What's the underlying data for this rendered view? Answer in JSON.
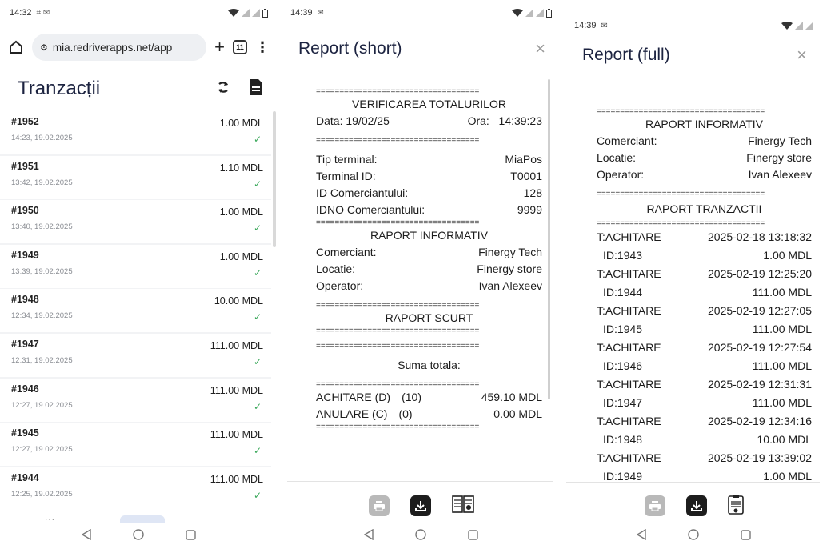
{
  "panel1": {
    "status_time": "14:32",
    "url": "mia.redriverapps.net/app",
    "tab_count": "11",
    "app_title": "Tranzacții",
    "transactions": [
      {
        "id": "#1952",
        "date": "14:23, 19.02.2025",
        "amount": "1.00 MDL"
      },
      {
        "id": "#1951",
        "date": "13:42, 19.02.2025",
        "amount": "1.10 MDL"
      },
      {
        "id": "#1950",
        "date": "13:40, 19.02.2025",
        "amount": "1.00 MDL"
      },
      {
        "id": "#1949",
        "date": "13:39, 19.02.2025",
        "amount": "1.00 MDL"
      },
      {
        "id": "#1948",
        "date": "12:34, 19.02.2025",
        "amount": "10.00 MDL"
      },
      {
        "id": "#1947",
        "date": "12:31, 19.02.2025",
        "amount": "111.00 MDL"
      },
      {
        "id": "#1946",
        "date": "12:27, 19.02.2025",
        "amount": "111.00 MDL"
      },
      {
        "id": "#1945",
        "date": "12:27, 19.02.2025",
        "amount": "111.00 MDL"
      },
      {
        "id": "#1944",
        "date": "12:25, 19.02.2025",
        "amount": "111.00 MDL"
      }
    ],
    "check_glyph": "✓"
  },
  "panel2": {
    "status_time": "14:39",
    "title": "Report (short)",
    "close": "×",
    "sep": "===================================",
    "verif_title": "VERIFICAREA TOTALURILOR",
    "data_label": "Data:",
    "data_value": "19/02/25",
    "ora_label": "Ora:",
    "ora_value": "14:39:23",
    "terminal_rows": [
      {
        "label": "Tip terminal:",
        "value": "MiaPos"
      },
      {
        "label": "Terminal ID:",
        "value": "T0001"
      },
      {
        "label": "ID Comerciantului:",
        "value": "128"
      },
      {
        "label": "IDNO Comerciantului:",
        "value": "9999"
      }
    ],
    "info_title": "RAPORT INFORMATIV",
    "info_rows": [
      {
        "label": "Comerciant:",
        "value": "Finergy Tech"
      },
      {
        "label": "Locatie:",
        "value": "Finergy store"
      },
      {
        "label": "Operator:",
        "value": "Ivan Alexeev"
      }
    ],
    "short_title": "RAPORT SCURT",
    "suma_title": "Suma totala:",
    "totals": [
      {
        "label": "ACHITARE (D)",
        "count": "(10)",
        "value": "459.10 MDL"
      },
      {
        "label": "ANULARE (C)",
        "count": "(0)",
        "value": "0.00 MDL"
      }
    ]
  },
  "panel3": {
    "status_time": "14:39",
    "title": "Report (full)",
    "close": "×",
    "sep": "====================================",
    "info_title": "RAPORT INFORMATIV",
    "info_rows": [
      {
        "label": "Comerciant:",
        "value": "Finergy Tech"
      },
      {
        "label": "Locatie:",
        "value": "Finergy store"
      },
      {
        "label": "Operator:",
        "value": "Ivan Alexeev"
      }
    ],
    "tx_title": "RAPORT TRANZACTII",
    "tx_rows": [
      {
        "type": "T:ACHITARE",
        "datetime": "2025-02-18 13:18:32",
        "id": "ID:1943",
        "amount": "1.00 MDL"
      },
      {
        "type": "T:ACHITARE",
        "datetime": "2025-02-19 12:25:20",
        "id": "ID:1944",
        "amount": "111.00 MDL"
      },
      {
        "type": "T:ACHITARE",
        "datetime": "2025-02-19 12:27:05",
        "id": "ID:1945",
        "amount": "111.00 MDL"
      },
      {
        "type": "T:ACHITARE",
        "datetime": "2025-02-19 12:27:54",
        "id": "ID:1946",
        "amount": "111.00 MDL"
      },
      {
        "type": "T:ACHITARE",
        "datetime": "2025-02-19 12:31:31",
        "id": "ID:1947",
        "amount": "111.00 MDL"
      },
      {
        "type": "T:ACHITARE",
        "datetime": "2025-02-19 12:34:16",
        "id": "ID:1948",
        "amount": "10.00 MDL"
      },
      {
        "type": "T:ACHITARE",
        "datetime": "2025-02-19 13:39:02",
        "id": "ID:1949",
        "amount": "1.00 MDL"
      }
    ]
  },
  "colors": {
    "check_green": "#3aa85a",
    "title_navy": "#1c2340",
    "list_bg": "#f2f3f5"
  },
  "icons": [
    "home-icon",
    "site-settings-icon",
    "plus-icon",
    "tabs-icon",
    "more-vert-icon",
    "refresh-icon",
    "document-icon",
    "check-icon",
    "close-icon",
    "print-icon",
    "download-icon",
    "book-icon",
    "back-nav-icon",
    "home-nav-icon",
    "recents-nav-icon"
  ]
}
